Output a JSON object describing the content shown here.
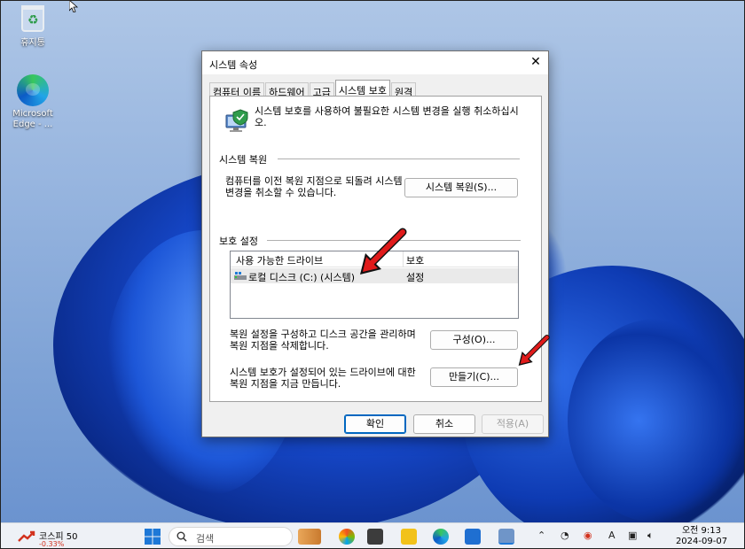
{
  "desktop": {
    "icons": [
      {
        "label": "휴지통"
      },
      {
        "label": "Microsoft Edge - ..."
      }
    ]
  },
  "dialog": {
    "title": "시스템 속성",
    "close_glyph": "✕",
    "tabs": [
      {
        "label": "컴퓨터 이름"
      },
      {
        "label": "하드웨어"
      },
      {
        "label": "고급"
      },
      {
        "label": "시스템 보호"
      },
      {
        "label": "원격"
      }
    ],
    "intro_text": "시스템 보호를 사용하여 불필요한 시스템 변경을 실행 취소하십시오.",
    "restore": {
      "section_title": "시스템 복원",
      "description": "컴퓨터를 이전 복원 지점으로 되돌려 시스템 변경을 취소할 수 있습니다.",
      "button_label": "시스템 복원(S)..."
    },
    "protection": {
      "section_title": "보호 설정",
      "columns": [
        "사용 가능한 드라이브",
        "보호"
      ],
      "drives": [
        {
          "name": "로컬 디스크 (C:) (시스템)",
          "status": "설정"
        }
      ],
      "configure_description": "복원 설정을 구성하고 디스크 공간을 관리하며 복원 지점을 삭제합니다.",
      "configure_button": "구성(O)...",
      "create_description": "시스템 보호가 설정되어 있는 드라이브에 대한 복원 지점을 지금 만듭니다.",
      "create_button": "만들기(C)..."
    },
    "footer": {
      "ok": "확인",
      "cancel": "취소",
      "apply": "적용(A)"
    }
  },
  "taskbar": {
    "weather_label": "코스피 50",
    "weather_sub": "-0.33%",
    "search_placeholder": "검색",
    "tray_ime": "A",
    "clock_time": "오전 9:13",
    "clock_date": "2024-09-07"
  }
}
